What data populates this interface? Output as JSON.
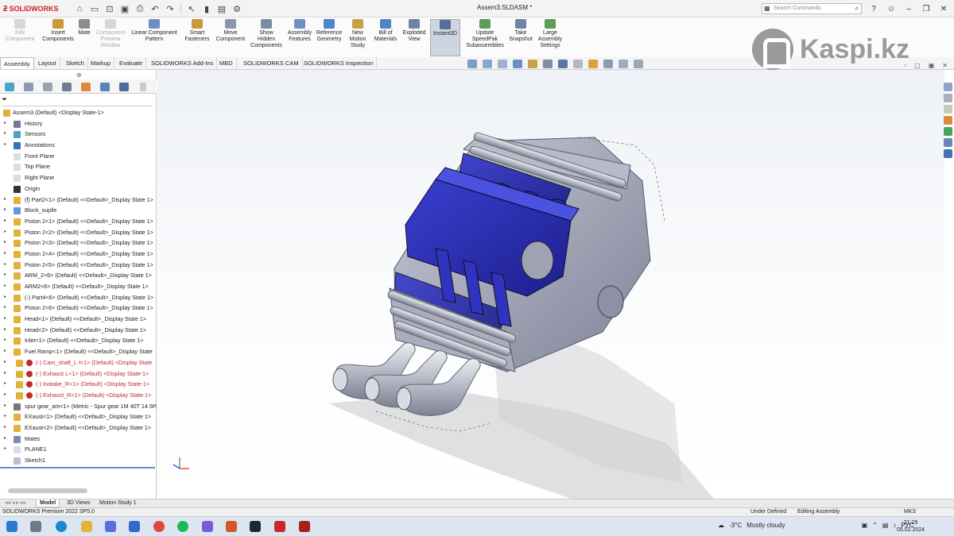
{
  "app": {
    "brand": "SOLIDWORKS",
    "window_title": "Assem3.SLDASM *",
    "search_placeholder": "Search Commands"
  },
  "ribbon": [
    {
      "label": "Edit Component",
      "disabled": true
    },
    {
      "label": "Insert Components",
      "disabled": false
    },
    {
      "label": "Mate",
      "disabled": false
    },
    {
      "label": "Component Preview Window",
      "disabled": true
    },
    {
      "label": "Linear Component Pattern",
      "disabled": false
    },
    {
      "label": "Smart Fasteners",
      "disabled": false
    },
    {
      "label": "Move Component",
      "disabled": false
    },
    {
      "label": "Show Hidden Components",
      "disabled": false
    },
    {
      "label": "Assembly Features",
      "disabled": false
    },
    {
      "label": "Reference Geometry",
      "disabled": false
    },
    {
      "label": "New Motion Study",
      "disabled": false
    },
    {
      "label": "Bill of Materials",
      "disabled": false
    },
    {
      "label": "Exploded View",
      "disabled": false
    },
    {
      "label": "Instant3D",
      "disabled": false,
      "active": true
    },
    {
      "label": "Update SpeedPak Subassemblies",
      "disabled": false
    },
    {
      "label": "Take Snapshot",
      "disabled": false
    },
    {
      "label": "Large Assembly Settings",
      "disabled": false
    }
  ],
  "tabs": [
    "Assembly",
    "Layout",
    "Sketch",
    "Markup",
    "Evaluate",
    "SOLIDWORKS Add-Ins",
    "MBD",
    "SOLIDWORKS CAM",
    "SOLIDWORKS Inspection"
  ],
  "watermark": "Kaspi.kz",
  "tree": {
    "root": "Assem3 (Default) <Display State-1>",
    "items": [
      {
        "label": "History",
        "icon": "history-icon",
        "error": false
      },
      {
        "label": "Sensors",
        "icon": "sensor-icon",
        "error": false
      },
      {
        "label": "Annotations",
        "icon": "annotation-icon",
        "error": false
      },
      {
        "label": "Front Plane",
        "icon": "plane-icon",
        "error": false
      },
      {
        "label": "Top Plane",
        "icon": "plane-icon",
        "error": false
      },
      {
        "label": "Right Plane",
        "icon": "plane-icon",
        "error": false
      },
      {
        "label": "Origin",
        "icon": "origin-icon",
        "error": false
      },
      {
        "label": "(f) Part2<1> (Default) <<Default>_Display State 1>",
        "icon": "part-icon",
        "error": false
      },
      {
        "label": "Block_suplle",
        "icon": "folder-icon",
        "error": false
      },
      {
        "label": "Piston 2<1> (Default) <<Default>_Display State 1>",
        "icon": "part-icon",
        "error": false
      },
      {
        "label": "Piston 2<2> (Default) <<Default>_Display State 1>",
        "icon": "part-icon",
        "error": false
      },
      {
        "label": "Piston 2<3> (Default) <<Default>_Display State 1>",
        "icon": "part-icon",
        "error": false
      },
      {
        "label": "Piston 2<4> (Default) <<Default>_Display State 1>",
        "icon": "part-icon",
        "error": false
      },
      {
        "label": "Piston 2<5> (Default) <<Default>_Display State 1>",
        "icon": "part-icon",
        "error": false
      },
      {
        "label": "ARM_2<6> (Default) <<Default>_Display State 1>",
        "icon": "part-icon",
        "error": false
      },
      {
        "label": "ARM2<6> (Default) <<Default>_Display State 1>",
        "icon": "part-icon",
        "error": false
      },
      {
        "label": "(-) Part4<6> (Default) <<Default>_Display State 1>",
        "icon": "part-icon",
        "error": false
      },
      {
        "label": "Piston 2<6> (Default) <<Default>_Display State 1>",
        "icon": "part-icon",
        "error": false
      },
      {
        "label": "Head<1> (Default) <<Default>_Display State 1>",
        "icon": "part-icon",
        "error": false
      },
      {
        "label": "Head<2> (Default) <<Default>_Display State 1>",
        "icon": "part-icon",
        "error": false
      },
      {
        "label": "Inlet<1> (Default) <<Default>_Display State 1>",
        "icon": "part-icon",
        "error": false
      },
      {
        "label": "Fuel Ramp<1> (Default) <<Default>_Display State",
        "icon": "part-icon",
        "error": false
      },
      {
        "label": "(-) Cam_shaft_L-l<1> (Default) <Display State",
        "icon": "part-icon",
        "error": true
      },
      {
        "label": "(-) Exhaust L<1> (Default) <Display State-1>",
        "icon": "part-icon",
        "error": true
      },
      {
        "label": "(-) Inatake_R<1> (Default) <Display State-1>",
        "icon": "part-icon",
        "error": true
      },
      {
        "label": "(-) Exhaust_R<1> (Default) <Display State-1>",
        "icon": "part-icon",
        "error": true
      },
      {
        "label": "spur gear_am<1> (Metric - Spur gear 1M 40T 14.5PA",
        "icon": "gear-icon",
        "error": false
      },
      {
        "label": "EXaust<1> (Default) <<Default>_Display State 1>",
        "icon": "part-icon",
        "error": false
      },
      {
        "label": "EXaust<2> (Default) <<Default>_Display State 1>",
        "icon": "part-icon",
        "error": false
      },
      {
        "label": "Mates",
        "icon": "mates-icon",
        "error": false
      },
      {
        "label": "PLANE1",
        "icon": "plane-icon",
        "error": false
      },
      {
        "label": "Sketch1",
        "icon": "sketch-icon",
        "error": false
      }
    ]
  },
  "bottom_tabs": [
    "Model",
    "3D Views",
    "Motion Study 1"
  ],
  "status": {
    "version": "SOLIDWORKS Premium 2022 SP5.0",
    "state": "Under Defined",
    "mode": "Editing Assembly",
    "units": "MKS"
  },
  "taskbar": {
    "weather_temp": "-3°C",
    "weather_text": "Mostly cloudy",
    "lang": "РУС",
    "time": "21:29",
    "date": "05.02.2024"
  },
  "colors": {
    "accent": "#d2232a",
    "part_blue": "#2a2fb8",
    "part_gray": "#9fa3b5",
    "error_red": "#c0282d"
  }
}
